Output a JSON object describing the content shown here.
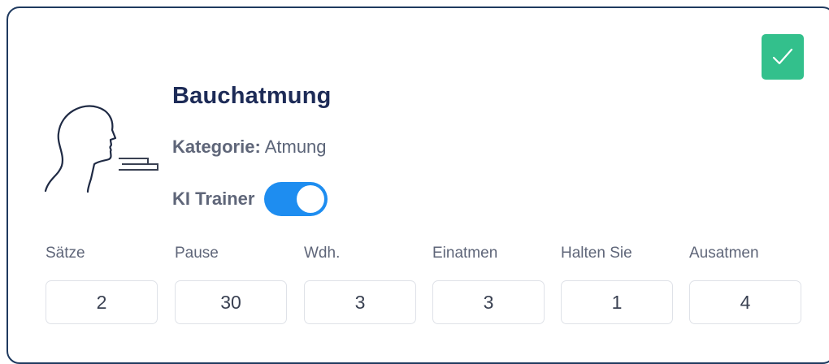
{
  "card": {
    "title": "Bauchatmung",
    "category_label": "Kategorie:",
    "category_value": "Atmung",
    "trainer_label": "KI Trainer",
    "trainer_enabled": true,
    "completed": true,
    "icon": "breathing-head-icon",
    "check_icon": "checkmark-icon"
  },
  "fields": [
    {
      "label": "Sätze",
      "value": "2"
    },
    {
      "label": "Pause",
      "value": "30"
    },
    {
      "label": "Wdh.",
      "value": "3"
    },
    {
      "label": "Einatmen",
      "value": "3"
    },
    {
      "label": "Halten Sie",
      "value": "1"
    },
    {
      "label": "Ausatmen",
      "value": "4"
    }
  ],
  "colors": {
    "accent_green": "#33c08c",
    "toggle_blue": "#1e8df0",
    "title": "#1d2b57",
    "border": "#1f3a5f"
  }
}
